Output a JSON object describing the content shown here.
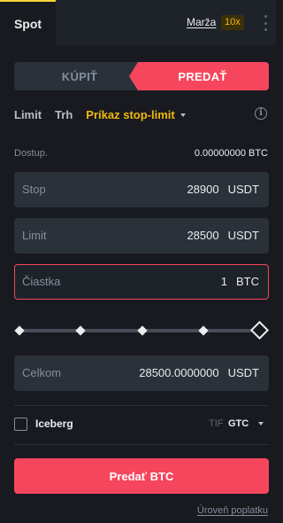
{
  "header": {
    "tab_spot": "Spot",
    "margin_label": "Marža",
    "leverage": "10x",
    "more_icon": "kebab-vertical-icon"
  },
  "side_toggle": {
    "buy": "KÚPIŤ",
    "sell": "PREDAŤ",
    "selected": "sell"
  },
  "order_types": {
    "limit": "Limit",
    "market": "Trh",
    "stop_limit": "Príkaz stop-limit",
    "selected": "stop_limit",
    "info_icon": "info-circle-icon"
  },
  "available": {
    "label": "Dostup.",
    "value": "0.00000000 BTC"
  },
  "fields": {
    "stop": {
      "label": "Stop",
      "value": "28900",
      "unit": "USDT"
    },
    "limit": {
      "label": "Limit",
      "value": "28500",
      "unit": "USDT"
    },
    "amount": {
      "label": "Čiastka",
      "value": "1",
      "unit": "BTC"
    },
    "total": {
      "label": "Celkom",
      "value": "28500.0000000",
      "unit": "USDT"
    }
  },
  "slider": {
    "percent": 100
  },
  "iceberg": {
    "label": "Iceberg",
    "checked": false
  },
  "tif": {
    "label": "TIF",
    "value": "GTC"
  },
  "submit": {
    "label": "Predať BTC"
  },
  "fee_link": "Úroveň poplatku",
  "colors": {
    "background": "#181a20",
    "panel": "#2b3139",
    "sell": "#f6465d",
    "accent": "#f0b90b"
  }
}
